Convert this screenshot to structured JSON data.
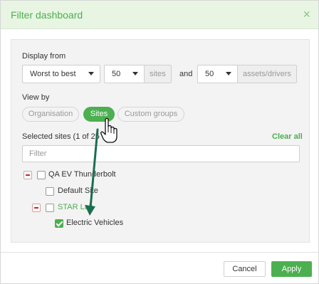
{
  "dialog": {
    "title": "Filter dashboard",
    "close_icon": "×"
  },
  "display_from": {
    "label": "Display from",
    "order_value": "Worst to best",
    "sites_count": "50",
    "sites_addon": "sites",
    "and_text": "and",
    "assets_count": "50",
    "assets_addon": "assets/drivers"
  },
  "view_by": {
    "label": "View by",
    "options": [
      "Organisation",
      "Sites",
      "Custom groups"
    ],
    "selected": "Sites"
  },
  "selected_sites": {
    "label": "Selected sites (1 of 25",
    "clear_all": "Clear all",
    "filter_placeholder": "Filter"
  },
  "tree": [
    {
      "label": "QA EV Thunderbolt",
      "expanded": true,
      "checked": false,
      "highlight": false
    },
    {
      "label": "Default Site",
      "expanded": false,
      "checked": false,
      "highlight": false
    },
    {
      "label": "STAR Lab",
      "expanded": true,
      "checked": false,
      "highlight": true
    },
    {
      "label": "Electric Vehicles",
      "expanded": false,
      "checked": true,
      "highlight": false
    }
  ],
  "footer": {
    "cancel_label": "Cancel",
    "apply_label": "Apply"
  },
  "annotation": {
    "arrow_color": "#1b6e4f",
    "pointer": "hand-pointer-icon"
  },
  "colors": {
    "accent": "#4caf50",
    "header_bg": "#e8f5e3",
    "minus": "#c62828"
  }
}
